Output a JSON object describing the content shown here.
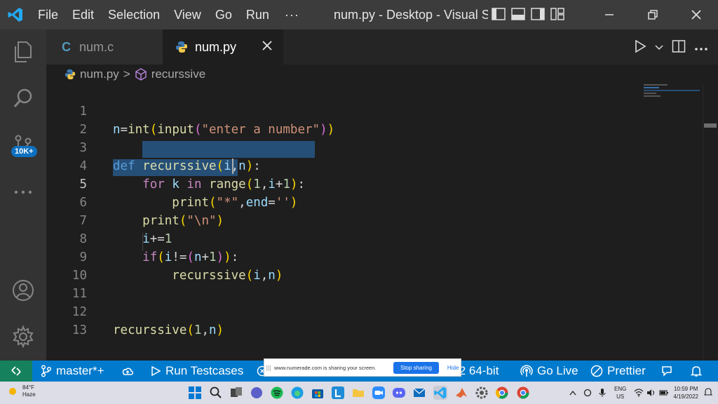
{
  "titlebar": {
    "menus": [
      "File",
      "Edit",
      "Selection",
      "View",
      "Go",
      "Run"
    ],
    "more": "···",
    "title": "num.py - Desktop - Visual S..."
  },
  "activity": {
    "badge": "10K+"
  },
  "tabs": [
    {
      "icon": "C",
      "label": "num.c"
    },
    {
      "label": "num.py"
    }
  ],
  "breadcrumb": {
    "file": "num.py",
    "separator": ">",
    "symbol": "recurssive"
  },
  "editor": {
    "line_numbers": [
      "1",
      "2",
      "3",
      "4",
      "5",
      "6",
      "7",
      "8",
      "9",
      "10",
      "11",
      "12",
      "13"
    ]
  },
  "statusbar": {
    "branch": "master*+",
    "run_testcases": "Run Testcases",
    "python": ".2 64-bit",
    "go_live": "Go Live",
    "prettier": "Prettier"
  },
  "share": {
    "grip": "|||",
    "message": "www.numerade.com is sharing your screen.",
    "stop": "Stop sharing",
    "hide": "Hide"
  },
  "taskbar": {
    "temp": "84°F",
    "weather": "Haze",
    "lang1": "ENG",
    "lang2": "US",
    "time": "10:59 PM",
    "date": "4/19/2022"
  },
  "colors": {
    "statusbar": "#007acc",
    "remote": "#16825d",
    "selection": "#264f78",
    "editor_bg": "#1e1e1e"
  }
}
